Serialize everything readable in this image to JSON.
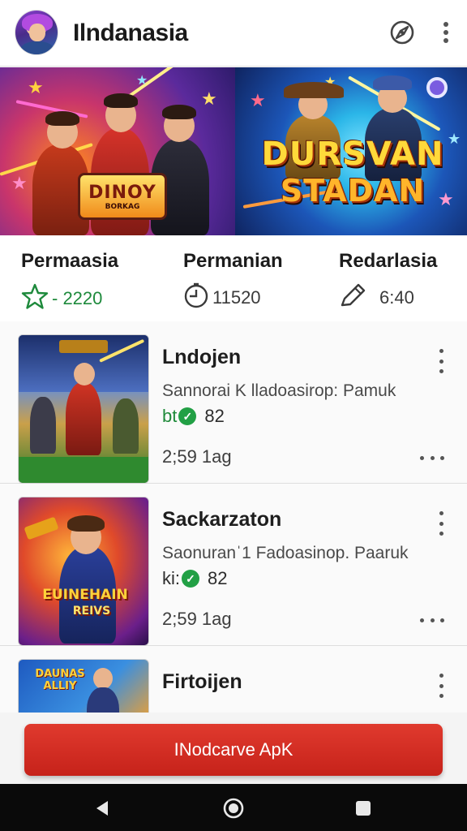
{
  "header": {
    "title": "Ilndanasia",
    "avatar_icon": "user-avatar",
    "action_icon": "compass-icon",
    "menu_icon": "more-vertical-icon"
  },
  "banner": {
    "left_logo_line1": "DINOY",
    "left_logo_line2": "BORKAG",
    "right_logo_line1": "DURSVAN",
    "right_logo_line2": "STADAN"
  },
  "stats": [
    {
      "label": "Permaasia",
      "icon": "star-outline-icon",
      "value": "- 2220"
    },
    {
      "label": "Permanian",
      "icon": "timer-icon",
      "value": "11520"
    },
    {
      "label": "Redarlasia",
      "icon": "pencil-icon",
      "value": "6:40"
    }
  ],
  "items": [
    {
      "title": "Lndojen",
      "subtitle": "Sannorai K lladoasirop: Pamuk",
      "rating_prefix": "bt",
      "rating": "82",
      "time": "2;59 1ag"
    },
    {
      "title": "Sackarzaton",
      "subtitle": "Saonuranˈ1 Fadoasinop. Paaruk",
      "rating_prefix": "ki:",
      "rating": "82",
      "time": "2;59 1ag"
    },
    {
      "title": "Firtoijen",
      "subtitle": "",
      "rating_prefix": "",
      "rating": "",
      "time": ""
    }
  ],
  "thumb2_logo": "EUINEHAIN",
  "thumb2_logo_small": "REIVS",
  "thumb3_logo": "DAUNAS ALLIY",
  "cta": {
    "label": "INodcarve ApK"
  },
  "nav": {
    "back_icon": "back-triangle-icon",
    "home_icon": "home-circle-icon",
    "recents_icon": "recents-square-icon"
  },
  "colors": {
    "accent_red": "#d12b20",
    "check_green": "#22a045",
    "stat_green": "#1e8a3c"
  }
}
